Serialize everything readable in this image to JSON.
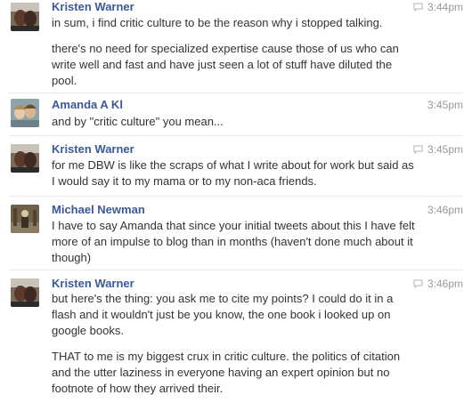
{
  "messages": [
    {
      "sender": "Kristen Warner",
      "time": "3:44pm",
      "icon": "chat-bubble-icon",
      "paragraphs": [
        "in sum, i find critic culture to be the reason why i stopped talking.",
        "there's no need for specialized expertise cause those of us who can write well and fast and have just seen a lot of stuff have diluted the pool."
      ]
    },
    {
      "sender": "Amanda A Kl",
      "time": "3:45pm",
      "paragraphs": [
        "and by \"critic culture\" you mean..."
      ]
    },
    {
      "sender": "Kristen Warner",
      "time": "3:45pm",
      "icon": "chat-bubble-icon",
      "paragraphs": [
        "for me DBW is like the scraps of what I write about for work but said as I would say it to my mama or to my non-aca friends."
      ]
    },
    {
      "sender": "Michael Newman",
      "time": "3:46pm",
      "paragraphs": [
        "I have to say Amanda that since your initial tweets about this I have felt more of an impulse to blog than in months (haven't done much about it though)"
      ]
    },
    {
      "sender": "Kristen Warner",
      "time": "3:46pm",
      "icon": "chat-bubble-icon",
      "paragraphs": [
        "but here's the thing: you ask me to cite my points? I could do it in a flash and it wouldn't just be you know, the one book i looked up on google books.",
        "THAT to me is my biggest crux in critic culture. the politics of citation and the utter laziness in everyone having an expert opinion but no footnote of how they arrived their."
      ]
    }
  ]
}
